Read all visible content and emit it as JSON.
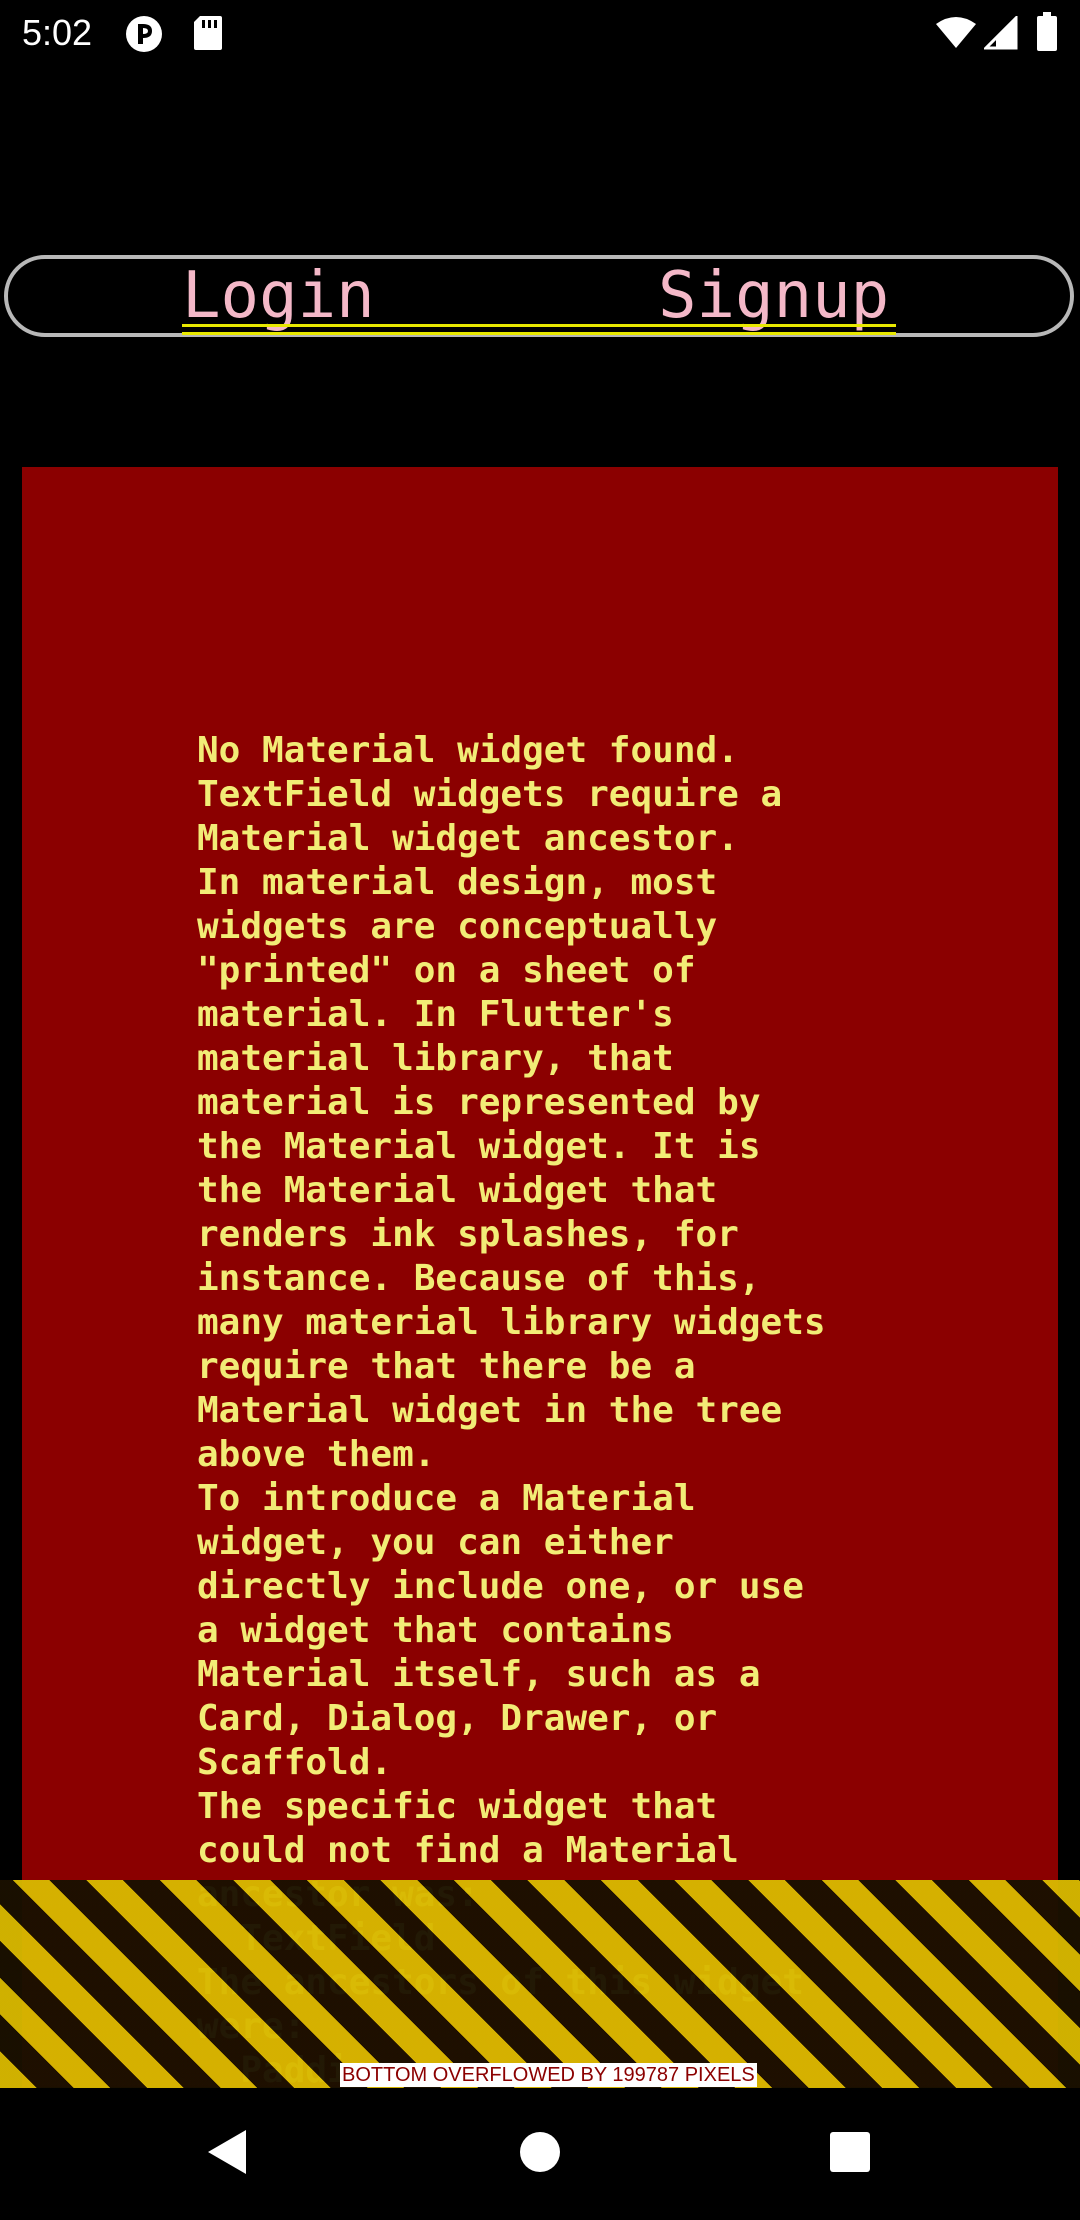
{
  "status_bar": {
    "time": "5:02",
    "icons": [
      "app-notification-icon",
      "sd-card-icon",
      "wifi-icon",
      "cell-signal-icon",
      "battery-icon"
    ]
  },
  "tabs": {
    "items": [
      {
        "label": "Login"
      },
      {
        "label": "Signup"
      }
    ],
    "text_color": "#f4b8c8",
    "underline_color": "#e8e800",
    "border_color": "#b8b8b8"
  },
  "error": {
    "background": "#8b0000",
    "text_color": "#f2ec76",
    "message": "No Material widget found.\nTextField widgets require a\nMaterial widget ancestor.\nIn material design, most\nwidgets are conceptually\n\"printed\" on a sheet of\nmaterial. In Flutter's\nmaterial library, that\nmaterial is represented by\nthe Material widget. It is\nthe Material widget that\nrenders ink splashes, for\ninstance. Because of this,\nmany material library widgets\nrequire that there be a\nMaterial widget in the tree\nabove them.\nTo introduce a Material\nwidget, you can either\ndirectly include one, or use\na widget that contains\nMaterial itself, such as a\nCard, Dialog, Drawer, or\nScaffold.\nThe specific widget that\ncould not find a Material\nancestor was:\n  TextField\nThe ancestors of this widget\nwere:\n  Padding"
  },
  "overflow": {
    "label": "BOTTOM OVERFLOWED BY 199787 PIXELS",
    "stripe_colors": [
      "#d8b800",
      "#1a1000"
    ]
  },
  "nav_bar": {
    "buttons": [
      "back-icon",
      "home-icon",
      "recents-icon"
    ]
  }
}
